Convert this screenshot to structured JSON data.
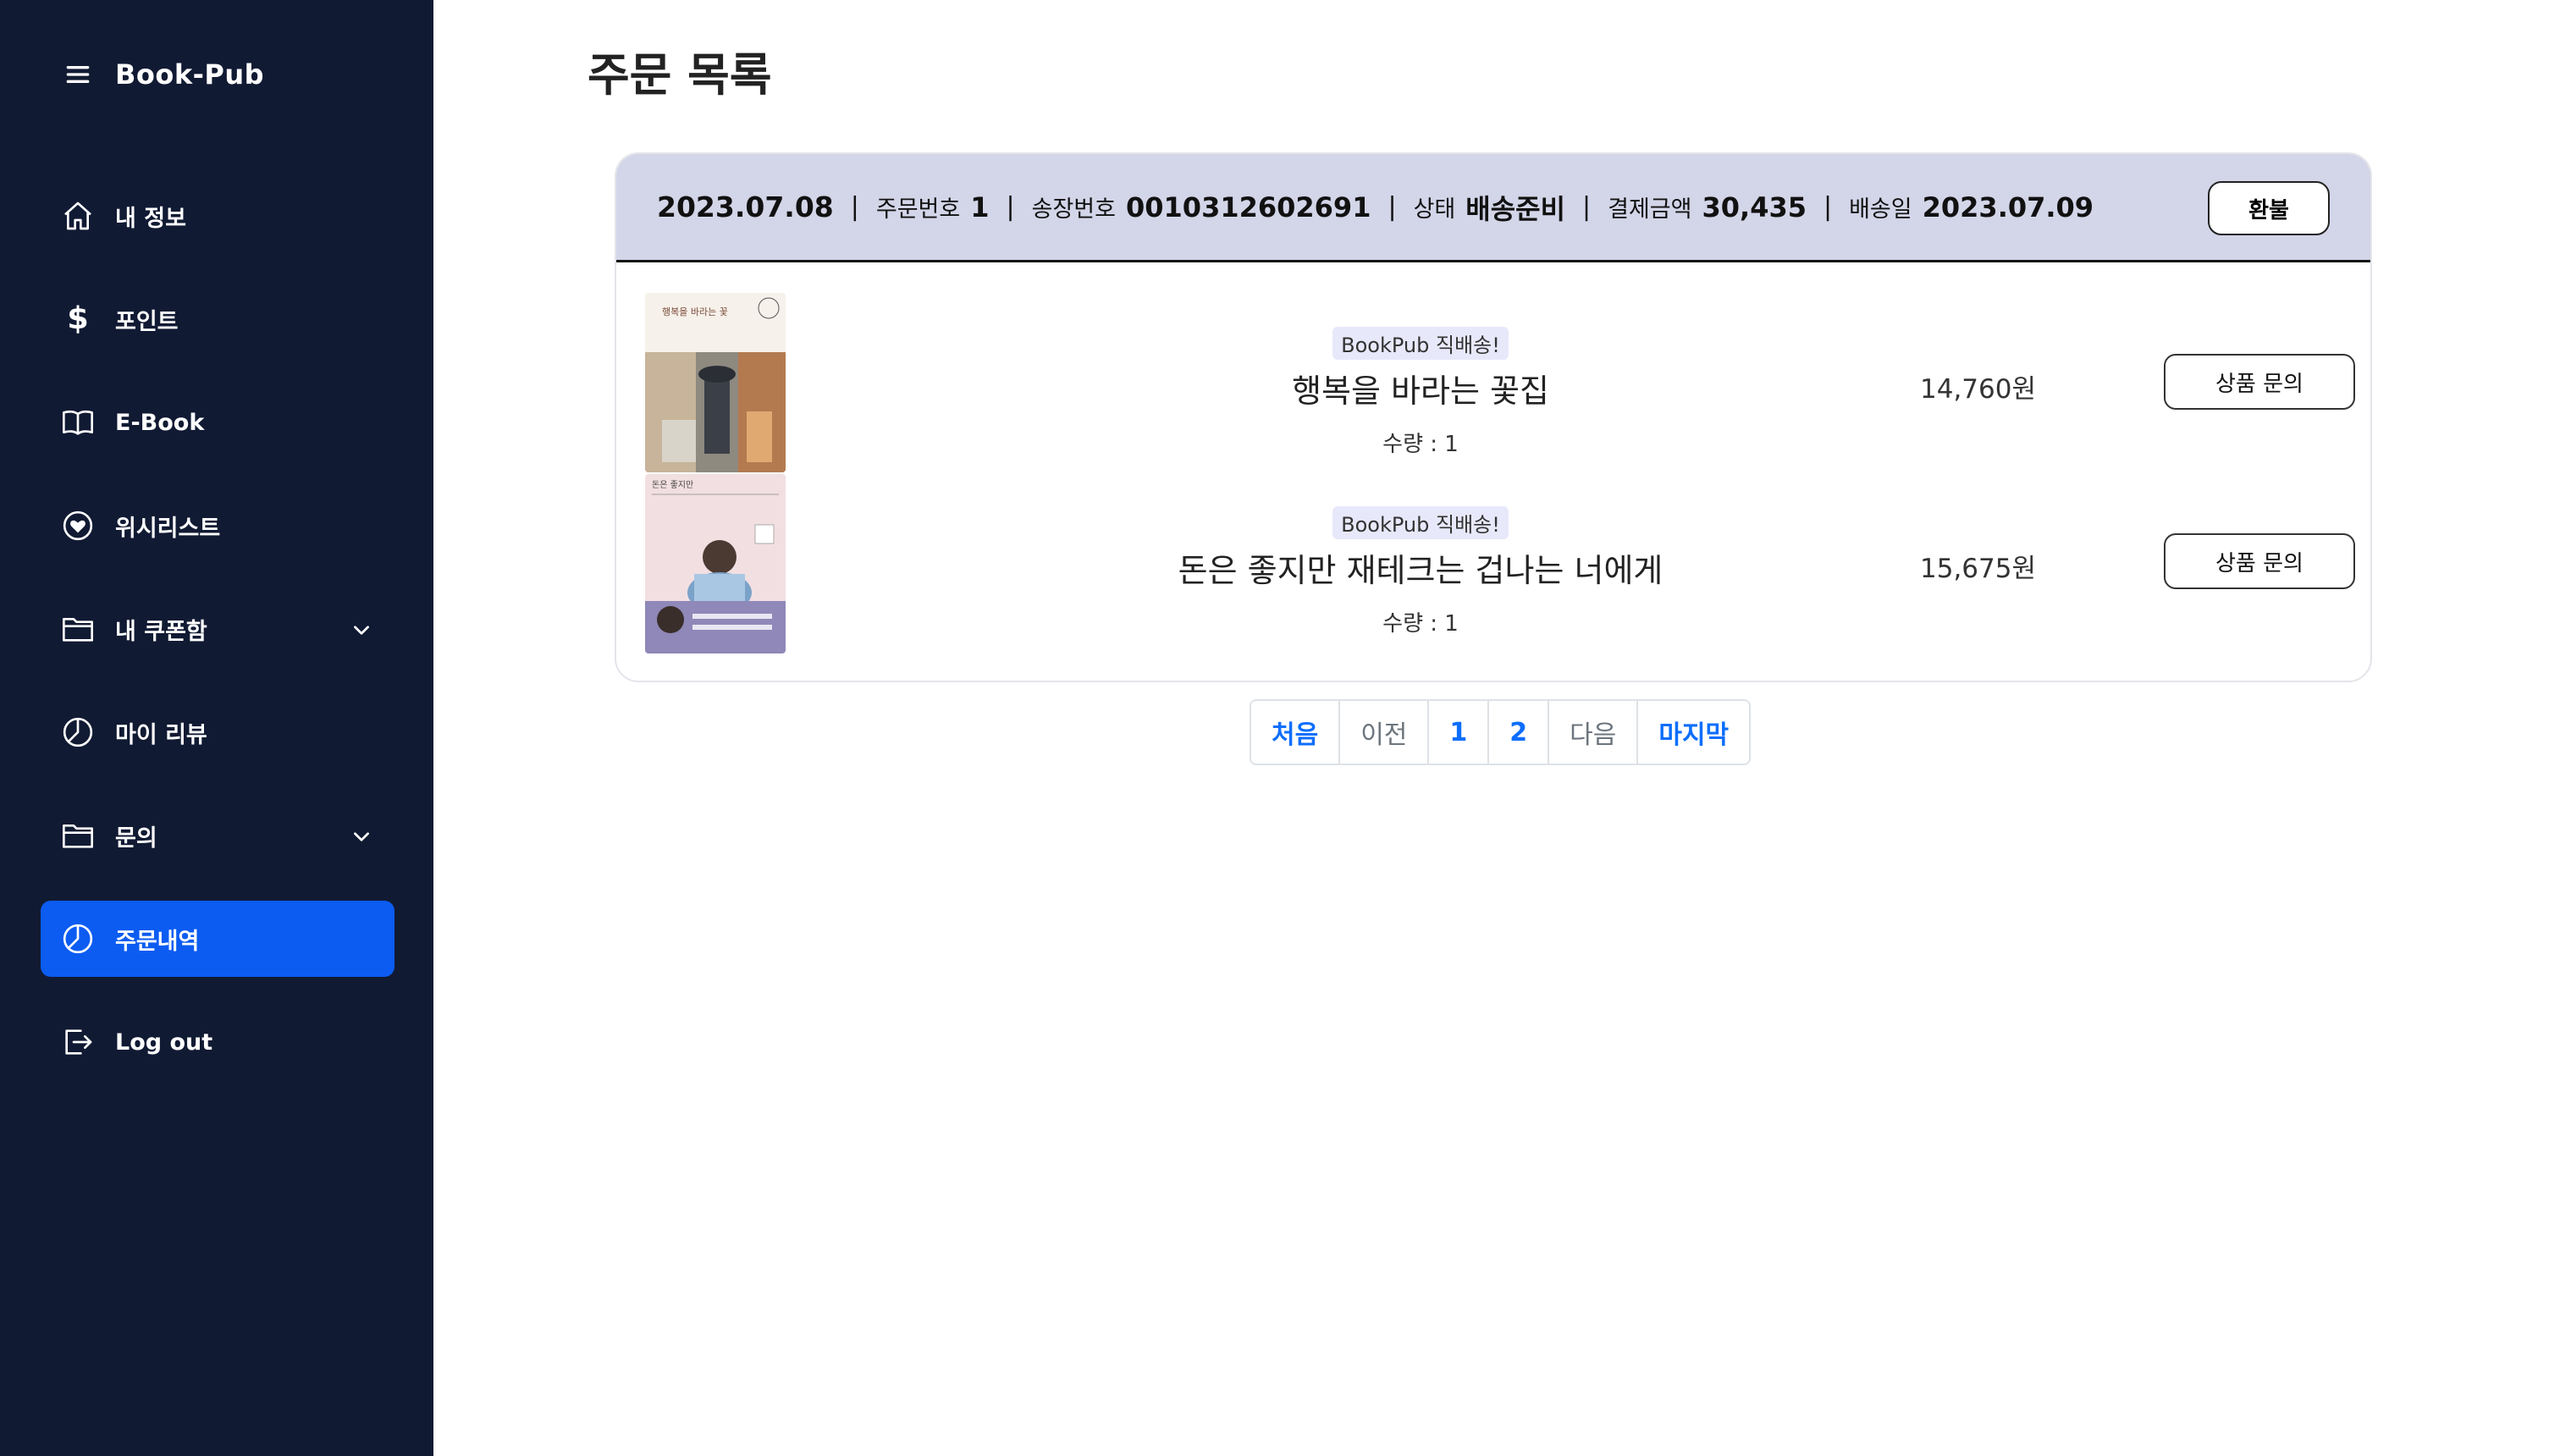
{
  "sidebar": {
    "brand": "Book-Pub",
    "items": [
      {
        "label": "내 정보",
        "icon": "home-icon"
      },
      {
        "label": "포인트",
        "icon": "dollar-icon"
      },
      {
        "label": "E-Book",
        "icon": "book-open-icon"
      },
      {
        "label": "위시리스트",
        "icon": "heart-circle-icon"
      },
      {
        "label": "내 쿠폰함",
        "icon": "folder-icon",
        "expandable": true
      },
      {
        "label": "마이 리뷰",
        "icon": "pie-chart-icon"
      },
      {
        "label": "문의",
        "icon": "folder-icon",
        "expandable": true
      },
      {
        "label": "주문내역",
        "icon": "pie-chart-icon",
        "active": true
      },
      {
        "label": "Log out",
        "icon": "logout-icon"
      }
    ]
  },
  "page": {
    "title": "주문 목록"
  },
  "order": {
    "date": "2023.07.08",
    "order_no_label": "주문번호",
    "order_no": "1",
    "tracking_label": "송장번호",
    "tracking_no": "0010312602691",
    "status_label": "상태",
    "status": "배송준비",
    "amount_label": "결제금액",
    "amount": "30,435",
    "ship_date_label": "배송일",
    "ship_date": "2023.07.09",
    "refund_label": "환불",
    "items": [
      {
        "badge": "BookPub 직배송!",
        "title": "행복을 바라는 꽃집",
        "qty": "수량 : 1",
        "price": "14,760원",
        "inquiry_label": "상품 문의",
        "cover_text": "행복을 바라는 꽃"
      },
      {
        "badge": "BookPub 직배송!",
        "title": "돈은 좋지만 재테크는 겁나는 너에게",
        "qty": "수량 : 1",
        "price": "15,675원",
        "inquiry_label": "상품 문의",
        "cover_text": "돈은 좋지만"
      }
    ]
  },
  "pagination": {
    "first": "처음",
    "prev": "이전",
    "pages": [
      "1",
      "2"
    ],
    "next": "다음",
    "last": "마지막"
  },
  "colors": {
    "sidebar_bg": "#111a33",
    "active_item": "#0c5cf2",
    "order_header_bg": "#d3d5e8",
    "link": "#0d6efd"
  }
}
